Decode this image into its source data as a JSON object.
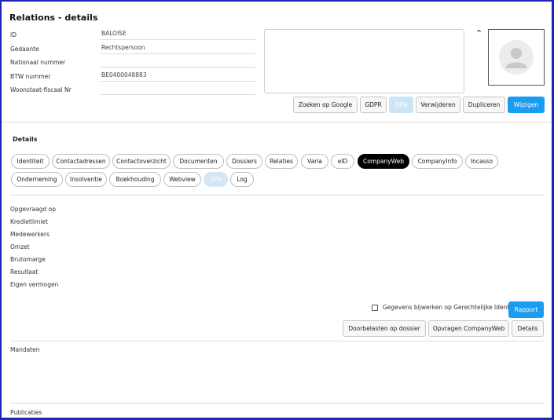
{
  "page": {
    "title": "Relations - details"
  },
  "fields": [
    {
      "label": "ID",
      "value": "BALOISE"
    },
    {
      "label": "Gedaante",
      "value": "Rechtspersoon"
    },
    {
      "label": "Nationaal nummer",
      "value": ""
    },
    {
      "label": "BTW nummer",
      "value": "BE0400048883"
    },
    {
      "label": "Woonstaat-fiscaal Nr",
      "value": ""
    }
  ],
  "header_actions": {
    "google": "Zoeken op Google",
    "gdpr": "GDPR",
    "dpa": "DPA",
    "delete": "Verwijderen",
    "duplicate": "Dupliceren",
    "edit": "Wijzigen"
  },
  "details": {
    "title": "Details",
    "tabs_row1": [
      "Identiteit",
      "Contactadressen",
      "Contactoverzicht",
      "Documenten",
      "Dossiers",
      "Relaties",
      "Varia",
      "eID",
      "CompanyWeb",
      "CompanyInfo",
      "Incasso"
    ],
    "tabs_row2": [
      "Onderneming",
      "Insolventie",
      "Boekhouding",
      "Webview",
      "DPA",
      "Log"
    ],
    "active_tab": "CompanyWeb",
    "disabled_tab": "DPA"
  },
  "companyweb": {
    "labels": [
      "Opgevraagd op",
      "Kredietlimiet",
      "Medewerkers",
      "Omzet",
      "Brutomarge",
      "Resultaat",
      "Eigen vermogen"
    ],
    "checkbox_label": "Gegevens bijwerken op Gerechtelijke Identiteit",
    "checkbox_checked": false,
    "rapport": "Rapport",
    "doorbelasten": "Doorbelasten op dossier",
    "opvragen": "Opvragen CompanyWeb",
    "details": "Details"
  },
  "sections": {
    "mandaten": "Mandaten",
    "publicaties": "Publicaties"
  },
  "colors": {
    "primary": "#1a9cf0",
    "frame": "#1e23b4",
    "active_tab": "#000000"
  }
}
